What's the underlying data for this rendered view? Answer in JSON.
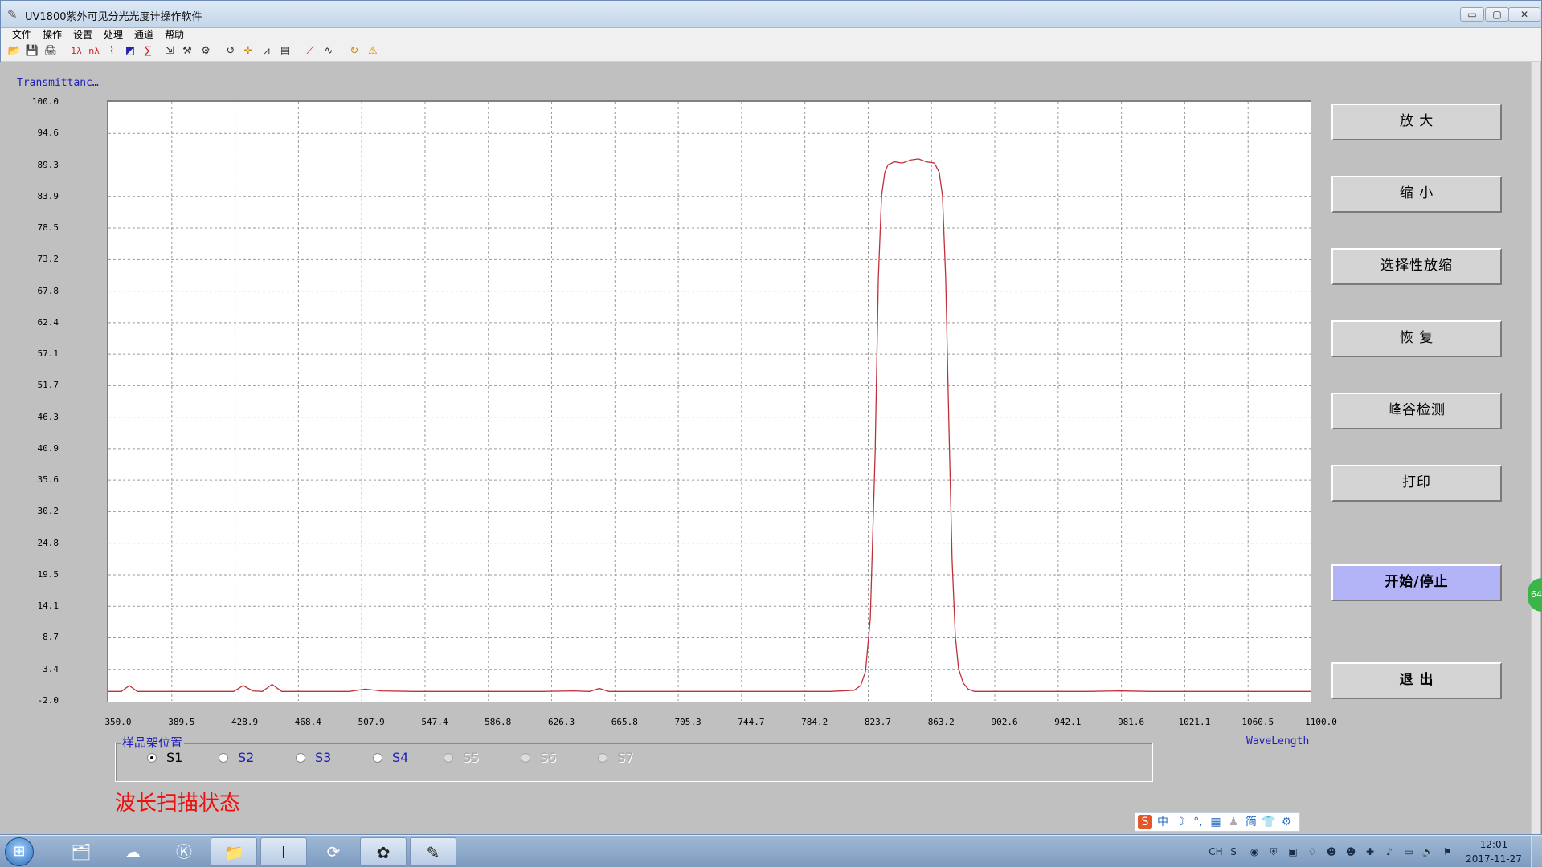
{
  "window": {
    "title": "UV1800紫外可见分光光度计操作软件",
    "controls": {
      "minimize": "▭",
      "maximize": "▢",
      "close": "✕"
    }
  },
  "menu": [
    "文件",
    "操作",
    "设置",
    "处理",
    "通道",
    "帮助"
  ],
  "toolbar_icons": [
    "open-file-icon",
    "save-icon",
    "print-icon",
    "lambda-icon",
    "multi-lambda-icon",
    "spectrum-icon",
    "kinetics-icon",
    "quant-icon",
    "export-icon",
    "tools-icon",
    "settings-icon",
    "undo-icon",
    "cross-hair-icon",
    "peak-icon",
    "window-icon",
    "graph-icon",
    "wave-icon",
    "refresh-icon",
    "warning-icon"
  ],
  "chart_data": {
    "type": "line",
    "ylabel": "Transmittanc…",
    "xlabel": "WaveLength",
    "xlim": [
      350.0,
      1100.0
    ],
    "ylim": [
      -2.0,
      100.0
    ],
    "x_ticks": [
      "350.0",
      "389.5",
      "428.9",
      "468.4",
      "507.9",
      "547.4",
      "586.8",
      "626.3",
      "665.8",
      "705.3",
      "744.7",
      "784.2",
      "823.7",
      "863.2",
      "902.6",
      "942.1",
      "981.6",
      "1021.1",
      "1060.5",
      "1100.0"
    ],
    "y_ticks": [
      "100.0",
      "94.6",
      "89.3",
      "83.9",
      "78.5",
      "73.2",
      "67.8",
      "62.4",
      "57.1",
      "51.7",
      "46.3",
      "40.9",
      "35.6",
      "30.2",
      "24.8",
      "19.5",
      "14.1",
      "8.7",
      "3.4",
      "-2.0"
    ],
    "grid": true,
    "line_color": "#c0303a",
    "series": [
      {
        "x": [
          350,
          358,
          363,
          368,
          380,
          395,
          405,
          428,
          434,
          440,
          446,
          452,
          458,
          470,
          500,
          510,
          520,
          540,
          560,
          580,
          600,
          620,
          640,
          650,
          656,
          662,
          680,
          700,
          740,
          780,
          800,
          815,
          819,
          822,
          825,
          828,
          830,
          832,
          834,
          836,
          840,
          845,
          850,
          855,
          860,
          865,
          868,
          870,
          872,
          874,
          876,
          878,
          880,
          883,
          886,
          890,
          900,
          920,
          940,
          960,
          980,
          1000,
          1020,
          1040,
          1060,
          1080,
          1100
        ],
        "y": [
          -0.4,
          -0.4,
          0.6,
          -0.4,
          -0.4,
          -0.4,
          -0.4,
          -0.4,
          0.6,
          -0.3,
          -0.4,
          0.8,
          -0.4,
          -0.4,
          -0.4,
          0.0,
          -0.3,
          -0.4,
          -0.4,
          -0.4,
          -0.4,
          -0.4,
          -0.3,
          -0.4,
          0.1,
          -0.4,
          -0.4,
          -0.4,
          -0.4,
          -0.4,
          -0.4,
          -0.2,
          0.6,
          3.0,
          12.0,
          40.0,
          70.0,
          84.0,
          88.0,
          89.3,
          89.8,
          89.6,
          90.1,
          90.3,
          89.8,
          89.6,
          88.0,
          84.0,
          70.0,
          45.0,
          22.0,
          9.0,
          3.5,
          1.0,
          0.0,
          -0.4,
          -0.4,
          -0.4,
          -0.4,
          -0.4,
          -0.3,
          -0.4,
          -0.4,
          -0.4,
          -0.4,
          -0.4,
          -0.4
        ]
      }
    ]
  },
  "sample_holder": {
    "legend": "样品架位置",
    "options": [
      {
        "label": "S1",
        "checked": true,
        "enabled": true
      },
      {
        "label": "S2",
        "checked": false,
        "enabled": true
      },
      {
        "label": "S3",
        "checked": false,
        "enabled": true
      },
      {
        "label": "S4",
        "checked": false,
        "enabled": true
      },
      {
        "label": "S5",
        "checked": false,
        "enabled": false
      },
      {
        "label": "S6",
        "checked": false,
        "enabled": false
      },
      {
        "label": "S7",
        "checked": false,
        "enabled": false
      }
    ]
  },
  "status_text": "波长扫描状态",
  "side_buttons": {
    "zoom_in": "放  大",
    "zoom_out": "缩  小",
    "selective_zoom": "选择性放缩",
    "restore": "恢  复",
    "peak_valley": "峰谷检测",
    "print": "打印",
    "start_stop": "开始/停止",
    "exit": "退  出"
  },
  "side_badge": "64",
  "ime_bar": [
    "S",
    "中",
    "☽",
    "°,",
    "▦",
    "♟",
    "简",
    "👕",
    "⚙"
  ],
  "taskbar": {
    "apps": [
      "explorer",
      "cloud",
      "k-app",
      "folder",
      "text-editor",
      "refresh-app",
      "sunflower-app",
      "uv-software"
    ],
    "tray_lang": "CH",
    "time": "12:01",
    "date": "2017-11-27"
  },
  "colors": {
    "client_bg": "#c0c0c0",
    "axis_text": "#1d1dba",
    "status_red": "#ee1010",
    "start_button": "#b3b3f7"
  }
}
